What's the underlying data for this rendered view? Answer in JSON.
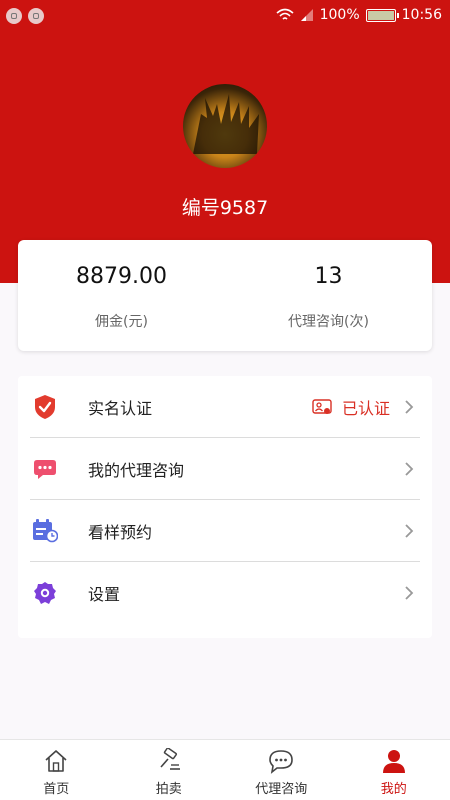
{
  "status_bar": {
    "signal": "100%",
    "time": "10:56"
  },
  "profile": {
    "user_id": "编号9587"
  },
  "stats": [
    {
      "value": "8879.00",
      "label": "佣金(元)"
    },
    {
      "value": "13",
      "label": "代理咨询(次)"
    }
  ],
  "menu": {
    "items": [
      {
        "label": "实名认证",
        "status": "已认证",
        "icon": "shield-check-icon"
      },
      {
        "label": "我的代理咨询",
        "icon": "chat-bubble-icon"
      },
      {
        "label": "看样预约",
        "icon": "calendar-clock-icon"
      },
      {
        "label": "设置",
        "icon": "gear-icon"
      }
    ]
  },
  "tabbar": {
    "items": [
      {
        "label": "首页",
        "icon": "home-icon"
      },
      {
        "label": "拍卖",
        "icon": "auction-hammer-icon"
      },
      {
        "label": "代理咨询",
        "icon": "chat-icon"
      },
      {
        "label": "我的",
        "icon": "person-icon",
        "active": true
      }
    ]
  },
  "colors": {
    "brand": "#cc1310",
    "status": "#d93025"
  }
}
